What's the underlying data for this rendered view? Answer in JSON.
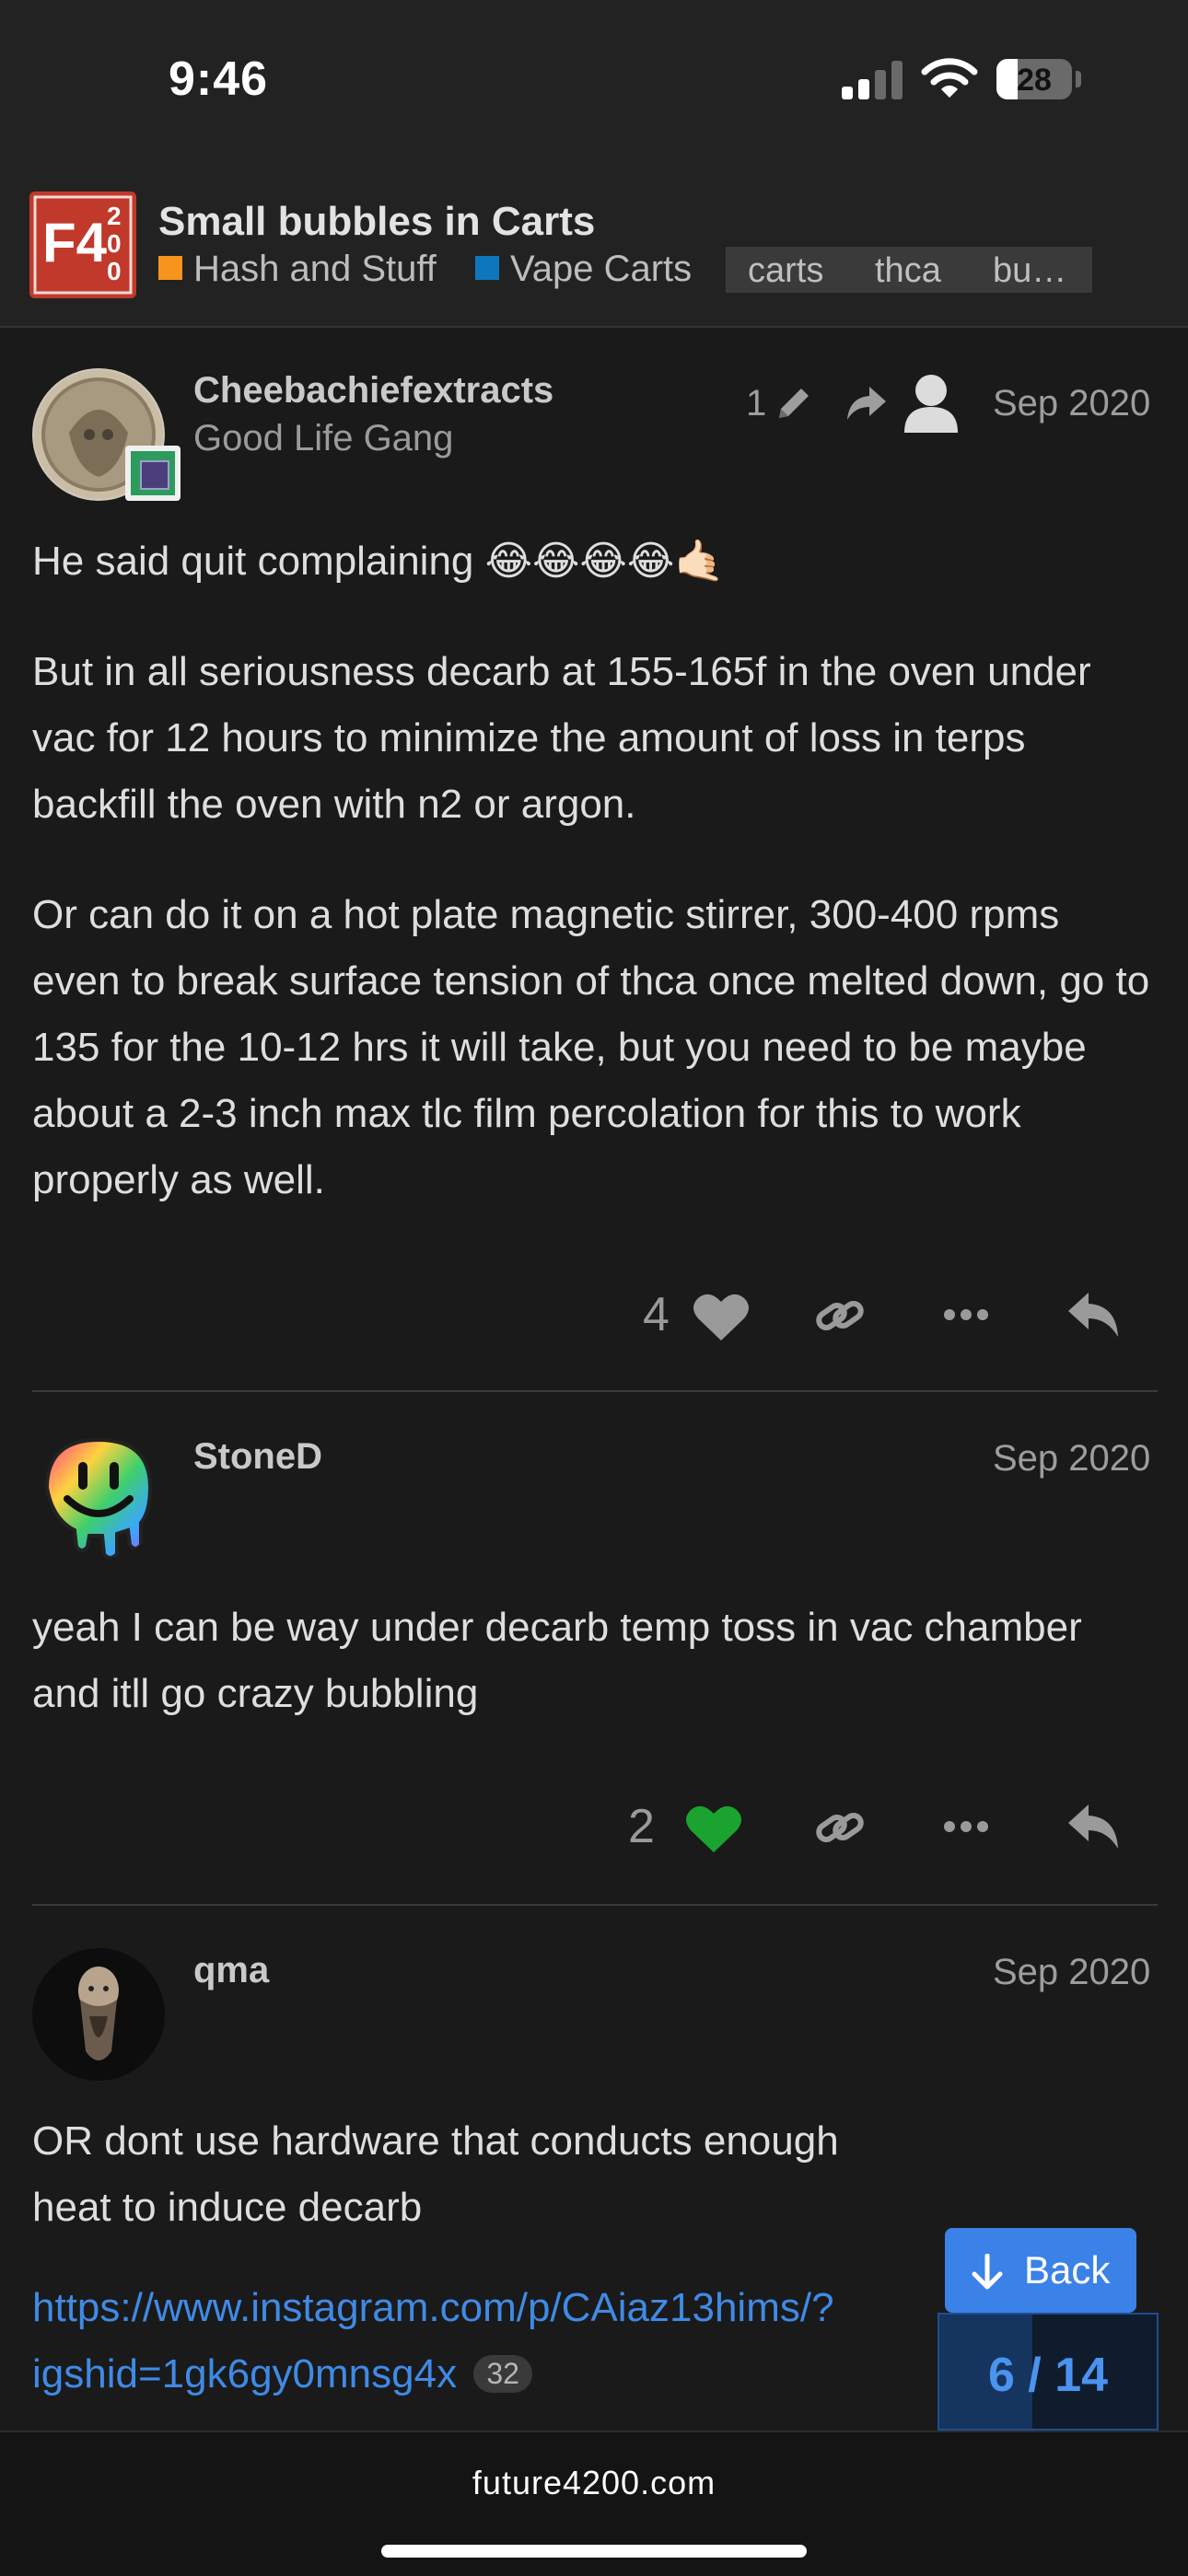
{
  "status_bar": {
    "time": "9:46",
    "battery": "28",
    "battery_level_pct": 28
  },
  "header": {
    "logo_text": "F4 2 0 0",
    "title": "Small bubbles in Carts",
    "categories": [
      {
        "name": "Hash and Stuff",
        "color": "#f7941d"
      },
      {
        "name": "Vape Carts",
        "color": "#0e76bd"
      }
    ],
    "tags": [
      "carts",
      "thca",
      "bu…"
    ]
  },
  "posts": [
    {
      "username": "Cheebachiefextracts",
      "user_title": "Good Life Gang",
      "edits": "1",
      "date": "Sep 2020",
      "paragraphs": [
        "He said quit complaining 😂😂😂😂🤙🏻",
        "But in all seriousness decarb at 155-165f in the oven under vac for 12 hours to minimize the amount of loss in terps backfill the oven with n2 or argon.",
        "Or can do it on a hot plate magnetic stirrer, 300-400 rpms even to break surface tension of thca once melted down, go to 135 for the 10-12 hrs it will take, but you need to be maybe about a 2-3 inch max tlc film percolation for this to work properly as well."
      ],
      "likes": "4",
      "liked": false
    },
    {
      "username": "StoneD",
      "date": "Sep 2020",
      "paragraphs": [
        "yeah I can be way under decarb temp toss in vac chamber and itll go crazy bubbling"
      ],
      "likes": "2",
      "liked": true
    },
    {
      "username": "qma",
      "date": "Sep 2020",
      "paragraphs": [
        "OR dont use hardware that conducts enough heat to induce decarb"
      ],
      "link_line1": "https://www.instagram.com/p/CAiaz13hims/?",
      "link_line2": "igshid=1gk6gy0mnsg4x",
      "link_clicks": "32"
    }
  ],
  "colors": {
    "accent": "#3b82e8",
    "like_active": "#1aa42f",
    "link": "#3f8ae6"
  },
  "icons": [
    "pencil-icon",
    "reply-arrow-icon",
    "user-icon",
    "heart-icon",
    "link-icon",
    "more-icon",
    "reply-icon",
    "arrow-down-icon"
  ],
  "nav": {
    "back_label": "Back",
    "progress_label": "6 / 14",
    "progress_current": 6,
    "progress_total": 14
  },
  "footer": {
    "domain": "future4200.com"
  }
}
